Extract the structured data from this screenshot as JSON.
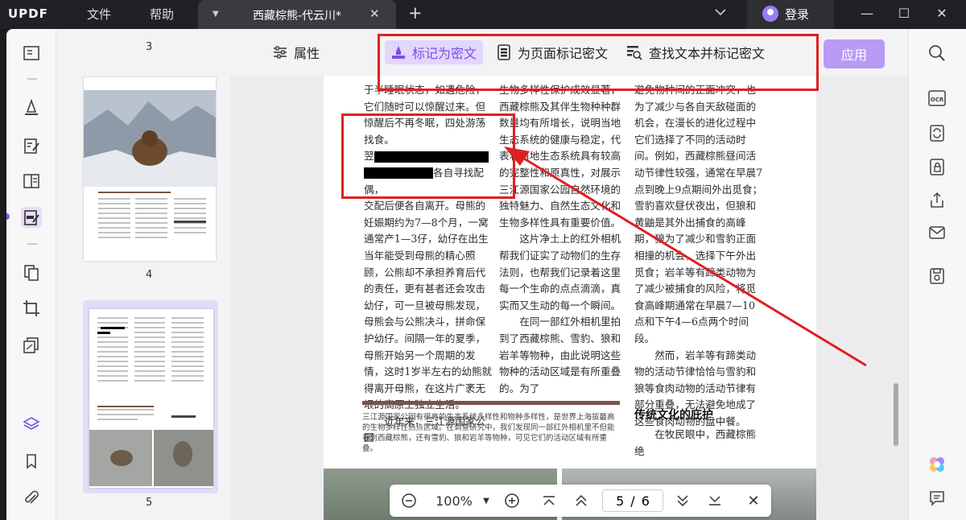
{
  "app": {
    "logo": "UPDF"
  },
  "menu": {
    "file": "文件",
    "help": "帮助"
  },
  "tab": {
    "title": "西藏棕熊-代云川*"
  },
  "account": {
    "login": "登录"
  },
  "thumbnails": {
    "page_numbers": [
      "3",
      "4",
      "5"
    ]
  },
  "toolbar": {
    "properties": "属性",
    "mark_redaction": "标记为密文",
    "mark_page_redaction": "为页面标记密文",
    "find_and_mark": "查找文本并标记密文",
    "apply": "应用"
  },
  "document": {
    "col1": [
      "于半睡眠状态，如遇危险，它们随时可以惊醒过来。但惊醒后不再冬眠，四处游荡找食。",
      "交配后便各自离开。母熊的妊娠期约为7—8个月，一窝通常产1—3仔，幼仔在出生当年能受到母熊的精心照顾，公熊却不承担养育后代的责任，更有甚者还会攻击幼仔，可一旦被母熊发现，母熊会与公熊决斗，拼命保护幼仔。间隔一年的夏季，母熊开始另一个周期的发情，这时1岁半左右的幼熊就得离开母熊，在这片广袤无垠的高原上独立生活。",
      "近年来，三江源国家公园"
    ],
    "col1_redact_prefix": "翌",
    "col1_redact_suffix": "各自寻找配偶，",
    "col2": [
      "生物多样性保护成效显著，西藏棕熊及其伴生物种种群数量均有所增长，说明当地生态系统的健康与稳定，代表着当地生态系统具有较高的完整性和原真性，对展示三江源国家公园自然环境的独特魅力、自然生态文化和生物多样性具有重要价值。",
      "这片净土上的红外相机帮我们证实了动物们的生存法则，也帮我们记录着这里每一个生命的点点滴滴，真实而又生动的每一个瞬间。",
      "在同一部红外相机里拍到了西藏棕熊、雪豹、狼和岩羊等物种，由此说明这些物种的活动区域是有所重叠的。为了"
    ],
    "col3": [
      "避免物种间的正面冲突，也为了减少与各自天敌碰面的机会，在漫长的进化过程中它们选择了不同的活动时间。例如，西藏棕熊昼间活动节律性较强，通常在早晨7点到晚上9点期间外出觅食；雪豹喜欢昼伏夜出，但狼和黄鼬是其外出捕食的高峰期，狼为了减少和雪豹正面相撞的机会，选择下午外出觅食；岩羊等有蹄类动物为了减少被捕食的风险，将觅食高峰期通常在早晨7—10点和下午4—6点两个时间段。",
      "然而，岩羊等有蹄类动物的活动节律恰恰与雪豹和狼等食肉动物的活动节律有部分重叠，无法避免地成了这些食肉动物的盘中餐。"
    ],
    "caption": "三江源国家公园有很高的生态系统多样性和物种多样性，是世界上海拔最高的生物多样性热点区域。在调查研究中，我们发现同一部红外相机里不但能看到西藏棕熊，还有雪豹、狼和岩羊等物种，可见它们的活动区域有所重叠。",
    "section_heading": "传统文化的庇护",
    "col3_after_heading": "在牧民眼中，西藏棕熊绝"
  },
  "zoom": {
    "level": "100%",
    "page_current": "5",
    "page_separator": "/",
    "page_total": "6"
  },
  "colors": {
    "accent": "#7a4fe8",
    "apply_bg": "#b99af6",
    "annotation_red": "#e02020"
  }
}
